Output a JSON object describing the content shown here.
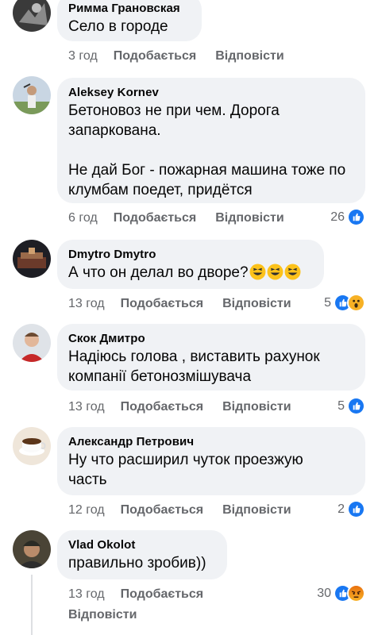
{
  "actions": {
    "like": "Подобається",
    "reply": "Відповісти"
  },
  "comments": [
    {
      "author": "Римма Грановская",
      "text": "Село в городе",
      "time": "3 год",
      "reactions": ""
    },
    {
      "author": "Aleksey Kornev",
      "text": "Бетоновоз не при чем. Дорога\nзапаркована.\n\nНе дай Бог - пожарная машина тоже по\nклумбам поедет, придётся",
      "time": "6 год",
      "reactions": "26"
    },
    {
      "author": "Dmytro Dmytro",
      "text": "А что он делал во дворе?",
      "time": "13 год",
      "reactions": "5"
    },
    {
      "author": "Скок Дмитро",
      "text": "Надіюсь голова , виставить рахунок\nкомпанії бетонозмішувача",
      "time": "13 год",
      "reactions": "5"
    },
    {
      "author": "Александр Петрович",
      "text": "Ну что расширил чуток проезжую\nчасть",
      "time": "12 год",
      "reactions": "2"
    },
    {
      "author": "Vlad  Okolot",
      "text": "правильно зробив))",
      "time": "13 год",
      "reactions": "30"
    }
  ],
  "colors": {
    "like_blue": "#1877f2",
    "bubble": "#f0f2f5",
    "meta_gray": "#65676b",
    "wow_yellow": "#f7b125",
    "angry_orange": "#e9710f"
  },
  "icons": [
    "like-reaction-icon",
    "wow-reaction-icon",
    "angry-reaction-icon",
    "laughing-emoji-icon"
  ]
}
